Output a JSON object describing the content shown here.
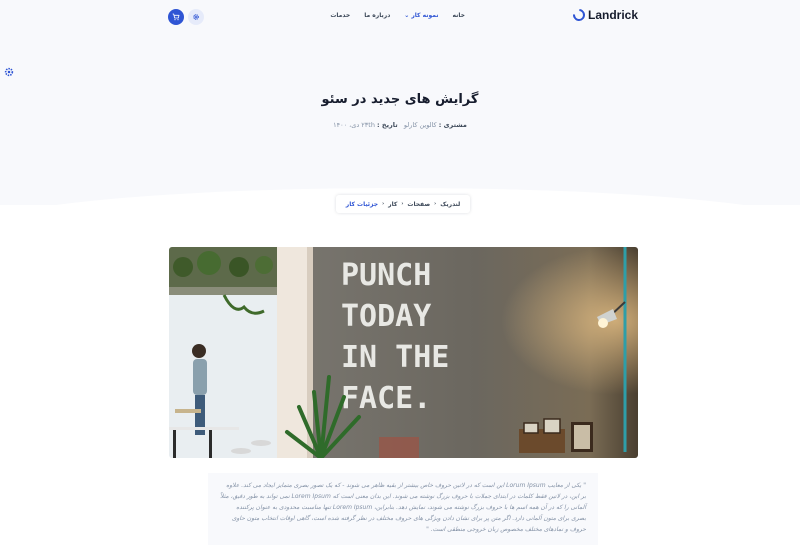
{
  "header": {
    "brand": "Landrick",
    "nav": [
      {
        "label": "خانه"
      },
      {
        "label": "نمونه کار",
        "active": true
      },
      {
        "label": "درباره ما"
      },
      {
        "label": "خدمات"
      }
    ],
    "icons": {
      "cart": "cart-icon",
      "settings": "gear-icon",
      "side_settings": "gear-icon"
    }
  },
  "hero": {
    "title": "گرایش های جدید در سئو",
    "client_label": "مشتری :",
    "client_value": "کالوین کارلو",
    "date_label": "تاریخ :",
    "date_value": "۲۳th دی، ۱۴۰۰"
  },
  "breadcrumb": [
    "لندریک",
    "صفحات",
    "کار",
    "جزئیات کار"
  ],
  "image": {
    "wall_text": [
      "PUNCH",
      "TODAY",
      "IN THE",
      "FACE."
    ]
  },
  "quote": {
    "text": "\" یکی از معایب Lorum Ipsum این است که در لاتین حروف خاص بیشتر از بقیه ظاهر می شوند - که یک تصور بصری متمایز ایجاد می کند. علاوه بر این، در لاتین فقط کلمات در ابتدای جملات با حروف بزرگ نوشته می شوند. این بدان معنی است که Lorem Ipsum نمی تواند به طور دقیق، مثلاً آلمانی را که در آن همه اسم ها با حروف بزرگ نوشته می شوند، نمایش دهد. بنابراین، Lorem Ipsum تنها مناسبت محدودی به عنوان پرکننده بصری برای متون آلمانی دارد. اگر متن پر برای نشان دادن ویژگی های حروف مختلف در نظر گرفته شده است، گاهی اوقات انتخاب متون حاوی حروف و نمادهای مختلف مخصوص زبان خروجی منطقی است. \""
  },
  "colors": {
    "primary": "#2f55d4",
    "heading": "#161c2d",
    "muted": "#8492a6",
    "soft": "#f8f9fc"
  }
}
